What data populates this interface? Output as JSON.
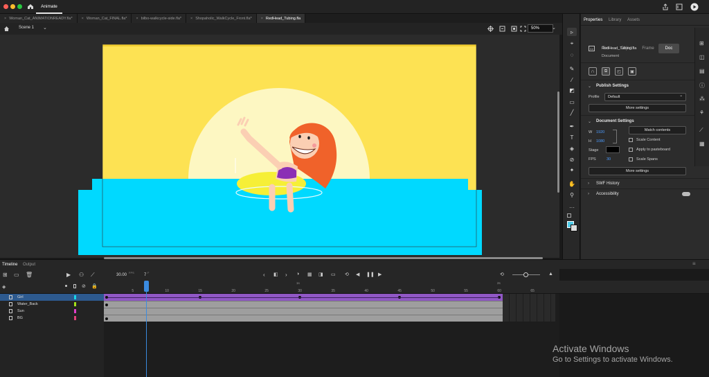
{
  "app": {
    "tab_label": "Animate"
  },
  "doc_tabs": [
    {
      "label": "Woman_Cat_ANIMATIONREADY.fla*",
      "active": false
    },
    {
      "label": "Woman_Cat_FINAL.fla*",
      "active": false
    },
    {
      "label": "bilbo-walkcycle-side.fla*",
      "active": false
    },
    {
      "label": "Shopaholic_WalkCycle_Front.fla*",
      "active": false
    },
    {
      "label": "RedHead_Tubing.fla",
      "active": true
    }
  ],
  "stage_toolbar": {
    "scene": "Scene 1",
    "zoom": "50%"
  },
  "properties": {
    "tabs": [
      "Properties",
      "Library",
      "Assets"
    ],
    "segments": [
      "Tool",
      "Object",
      "Frame",
      "Doc"
    ],
    "file_name": "RedHead_Tubing.fla",
    "file_type": "Document",
    "publish": {
      "title": "Publish Settings",
      "profile_label": "Profile",
      "profile_value": "Default",
      "more": "More settings"
    },
    "document": {
      "title": "Document Settings",
      "w_label": "W",
      "w_value": "1920",
      "h_label": "H",
      "h_value": "1080",
      "match": "Match contents",
      "scale_content": "Scale Content",
      "apply_pasteboard": "Apply to pasteboard",
      "scale_spans": "Scale Spans",
      "stage_label": "Stage",
      "stage_color": "#000000",
      "fps_label": "FPS",
      "fps_value": "30",
      "more": "More settings"
    },
    "swf_history": "SWF History",
    "accessibility": "Accessibility"
  },
  "timeline": {
    "tabs": [
      "Timeline",
      "Output"
    ],
    "fps": "30.00",
    "fps_unit": "FPS",
    "frame": "7",
    "frame_unit": "F",
    "ruler": [
      {
        "n": "5"
      },
      {
        "n": "10"
      },
      {
        "n": "15"
      },
      {
        "n": "20"
      },
      {
        "n": "25"
      },
      {
        "n": "30"
      },
      {
        "n": "35"
      },
      {
        "n": "40"
      },
      {
        "n": "45"
      },
      {
        "n": "50"
      },
      {
        "n": "55"
      },
      {
        "n": "60"
      },
      {
        "n": "65"
      }
    ],
    "second_marks": [
      "1s",
      "2s"
    ],
    "layers": [
      {
        "name": "Girl",
        "color": "#18d6e8",
        "selected": true
      },
      {
        "name": "Water_Back",
        "color": "#a3e01a",
        "selected": false
      },
      {
        "name": "Sun",
        "color": "#e03fc9",
        "selected": false
      },
      {
        "name": "BG",
        "color": "#e0407a",
        "selected": false
      }
    ]
  },
  "watermark": {
    "title": "Activate Windows",
    "subtitle": "Go to Settings to activate Windows."
  },
  "colors": {
    "sky": "#fde253",
    "sun": "#fdf7c2",
    "water": "#00d9ff",
    "tween": "#9058c5",
    "span": "#9e9e9e",
    "accent": "#3b8be0"
  }
}
